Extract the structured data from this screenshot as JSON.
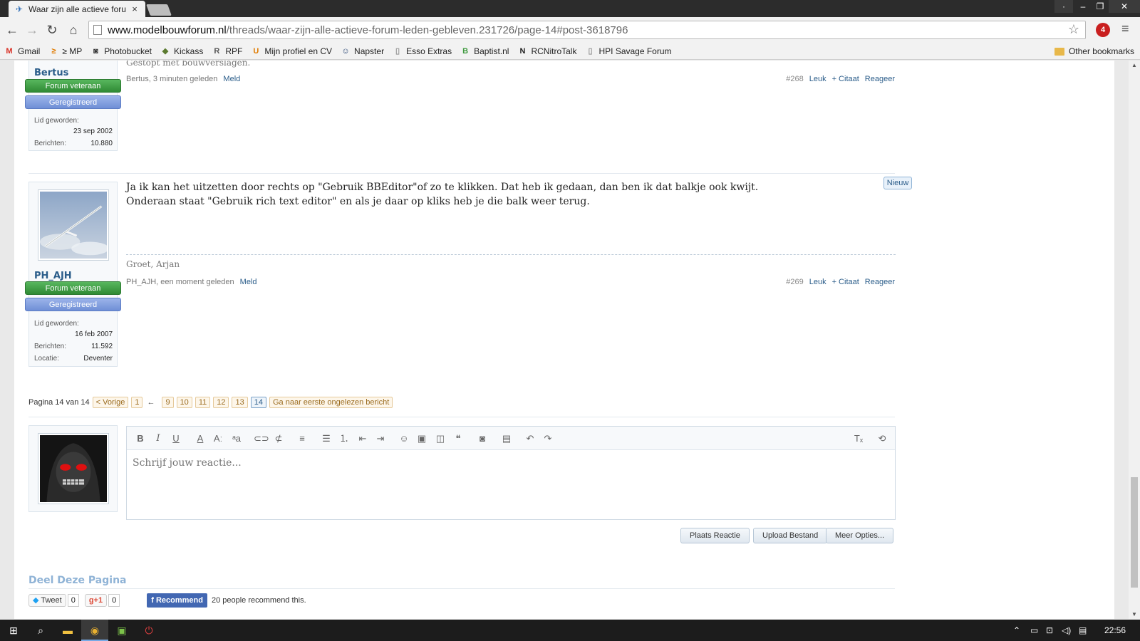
{
  "browser": {
    "tab_title": "Waar zijn alle actieve foru",
    "tab_close": "×",
    "url_domain": "www.modelbouwforum.nl",
    "url_path": "/threads/waar-zijn-alle-actieve-forum-leden-gebleven.231726/page-14#post-3618796",
    "ext_badge": "4",
    "window_dots": "·"
  },
  "bookmarks": {
    "items": [
      {
        "label": "Gmail",
        "icon": "gmail-icon",
        "color": "#d93025",
        "glyph": "M"
      },
      {
        "label": "≥ MP",
        "icon": "mp-icon",
        "color": "#e07b00",
        "glyph": "≥"
      },
      {
        "label": "Photobucket",
        "icon": "photobucket-icon",
        "color": "#333333",
        "glyph": "◙"
      },
      {
        "label": "Kickass",
        "icon": "kickass-icon",
        "color": "#5b7a2f",
        "glyph": "◆"
      },
      {
        "label": "RPF",
        "icon": "rpf-icon",
        "color": "#555555",
        "glyph": "R"
      },
      {
        "label": "Mijn profiel en CV",
        "icon": "ubm-icon",
        "color": "#e07b00",
        "glyph": "U"
      },
      {
        "label": "Napster",
        "icon": "napster-icon",
        "color": "#1b3a6b",
        "glyph": "☺"
      },
      {
        "label": "Esso Extras",
        "icon": "page-icon",
        "color": "#999999",
        "glyph": "▯"
      },
      {
        "label": "Baptist.nl",
        "icon": "baptist-icon",
        "color": "#3f9a3f",
        "glyph": "B"
      },
      {
        "label": "RCNitroTalk",
        "icon": "rcnitro-icon",
        "color": "#222222",
        "glyph": "N"
      },
      {
        "label": "HPI Savage Forum",
        "icon": "page-icon",
        "color": "#999999",
        "glyph": "▯"
      }
    ],
    "other": "Other bookmarks"
  },
  "posts": [
    {
      "username": "Bertus",
      "title_badge": "Forum veteraan",
      "reg_badge": "Geregistreerd",
      "info": [
        {
          "label": "Lid geworden:",
          "value": ""
        },
        {
          "label": "",
          "value": "23 sep 2002"
        },
        {
          "label": "Berichten:",
          "value": "10.880"
        }
      ],
      "signature": "Gestopt met bouwverslagen.",
      "meta_user": "Bertus, 3 minuten geleden",
      "report": "Meld",
      "number": "#268",
      "like": "Leuk",
      "quote": "+ Citaat",
      "reply": "Reageer"
    },
    {
      "username": "PH_AJH",
      "title_badge": "Forum veteraan",
      "reg_badge": "Geregistreerd",
      "info": [
        {
          "label": "Lid geworden:",
          "value": ""
        },
        {
          "label": "",
          "value": "16 feb 2007"
        },
        {
          "label": "Berichten:",
          "value": "11.592"
        },
        {
          "label": "Locatie:",
          "value": "Deventer"
        }
      ],
      "new_badge": "Nieuw",
      "text_line1": "Ja ik kan het uitzetten door rechts op \"Gebruik BBEditor\"of zo te klikken. Dat heb ik gedaan, dan ben ik dat balkje ook kwijt.",
      "text_line2": "Onderaan staat \"Gebruik rich text editor\" en als je daar op kliks heb je die balk weer terug.",
      "signature": "Groet, Arjan",
      "meta_user": "PH_AJH, een moment geleden",
      "report": "Meld",
      "number": "#269",
      "like": "Leuk",
      "quote": "+ Citaat",
      "reply": "Reageer"
    }
  ],
  "pager": {
    "label": "Pagina 14 van 14",
    "prev": "< Vorige",
    "first": "1",
    "dots": "←",
    "pages": [
      "9",
      "10",
      "11",
      "12",
      "13",
      "14"
    ],
    "current": "14",
    "unread": "Ga naar eerste ongelezen bericht"
  },
  "editor": {
    "placeholder": "Schrijf jouw reactie...",
    "submit": "Plaats Reactie",
    "upload": "Upload Bestand",
    "more": "Meer Opties..."
  },
  "share": {
    "title": "Deel Deze Pagina",
    "tweet": "Tweet",
    "tweet_count": "0",
    "gplus": "g+1",
    "gplus_count": "0",
    "fb": "Recommend",
    "fb_text": "20 people recommend this."
  },
  "taskbar": {
    "time": "22:56"
  }
}
